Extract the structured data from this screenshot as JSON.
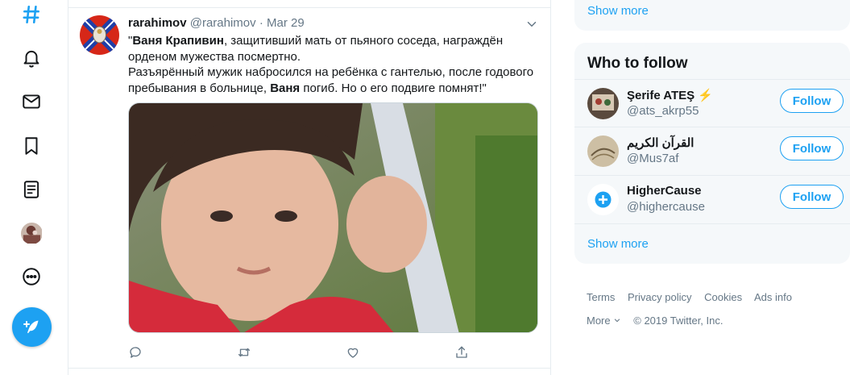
{
  "nav": {
    "items": [
      "hashtag-icon",
      "bell-icon",
      "mail-icon",
      "bookmark-icon",
      "list-icon",
      "profile-avatar",
      "more-icon"
    ],
    "compose_icon": "compose-tweet-icon"
  },
  "tweet": {
    "name": "rarahimov",
    "handle": "@rarahimov",
    "dot": "·",
    "date": "Mar 29",
    "text": {
      "p1_quote": "\"",
      "p1_bold": "Ваня Крапивин",
      "p1_rest": ", защитивший мать от пьяного соседа, награждён орденом мужества посмертно.",
      "p2_start": "Разъярённый мужик набросился на ребёнка с гантелью, после годового пребывания в больнице, ",
      "p2_bold": "Ваня",
      "p2_end": " погиб. Но о его подвиге помнят!\""
    }
  },
  "right": {
    "top_show_more": "Show more",
    "who_to_follow": {
      "title": "Who to follow",
      "users": [
        {
          "name": "Şerife ATEŞ ⚡",
          "handle": "@ats_akrp55",
          "button": "Follow"
        },
        {
          "name": "القرآن الكريم",
          "handle": "@Mus7af",
          "button": "Follow"
        },
        {
          "name": "HigherCause",
          "handle": "@highercause",
          "button": "Follow"
        }
      ],
      "show_more": "Show more"
    },
    "footer": {
      "links": [
        "Terms",
        "Privacy policy",
        "Cookies",
        "Ads info"
      ],
      "more": "More",
      "copyright": "© 2019 Twitter, Inc."
    }
  },
  "colors": {
    "accent": "#1da1f2",
    "text": "#14171a",
    "muted": "#657786",
    "border": "#e6ecf0",
    "panel": "#f5f8fa"
  }
}
